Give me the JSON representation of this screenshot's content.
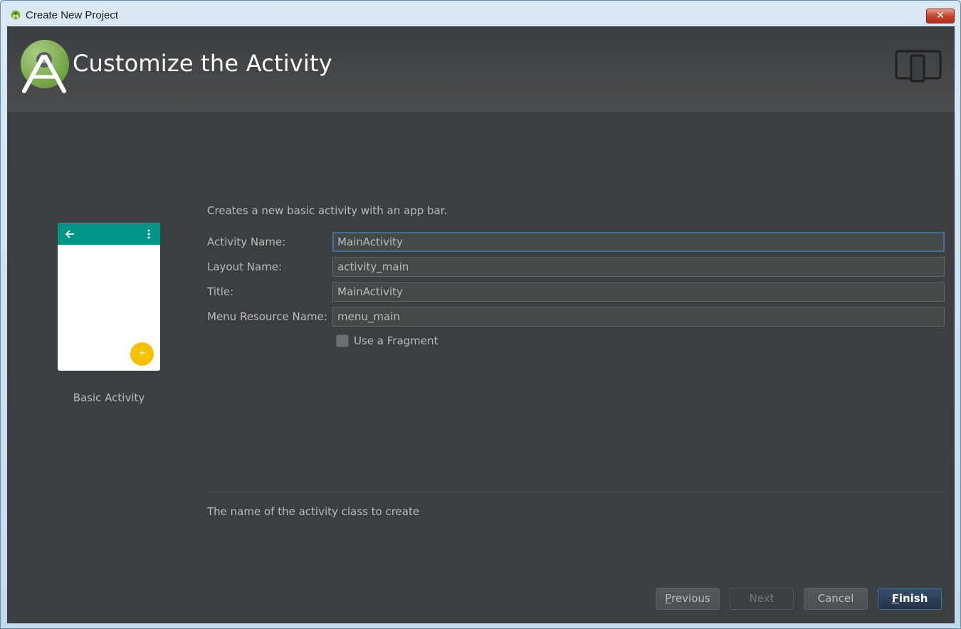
{
  "window": {
    "title": "Create New Project",
    "close_symbol": "✕"
  },
  "header": {
    "title": "Customize the Activity",
    "logo_icon": "android-studio-logo-icon",
    "device_icon": "tablet-phone-icon"
  },
  "preview": {
    "caption": "Basic Activity",
    "fab_symbol": "+",
    "appbar_color": "#009587",
    "fab_color": "#f5c000"
  },
  "form": {
    "description": "Creates a new basic activity with an app bar.",
    "fields": [
      {
        "label": "Activity Name:",
        "value": "MainActivity"
      },
      {
        "label": "Layout Name:",
        "value": "activity_main"
      },
      {
        "label": "Title:",
        "value": "MainActivity"
      },
      {
        "label": "Menu Resource Name:",
        "value": "menu_main"
      }
    ],
    "use_fragment": {
      "label": "Use a Fragment",
      "checked": false
    }
  },
  "hint": "The name of the activity class to create",
  "buttons": {
    "previous": {
      "mnemonic": "P",
      "rest": "revious"
    },
    "next": "Next",
    "cancel": "Cancel",
    "finish": {
      "mnemonic": "F",
      "rest": "inish"
    }
  },
  "colors": {
    "background": "#3c3f41",
    "text": "#bbbbbb",
    "focus_border": "#466d94"
  }
}
